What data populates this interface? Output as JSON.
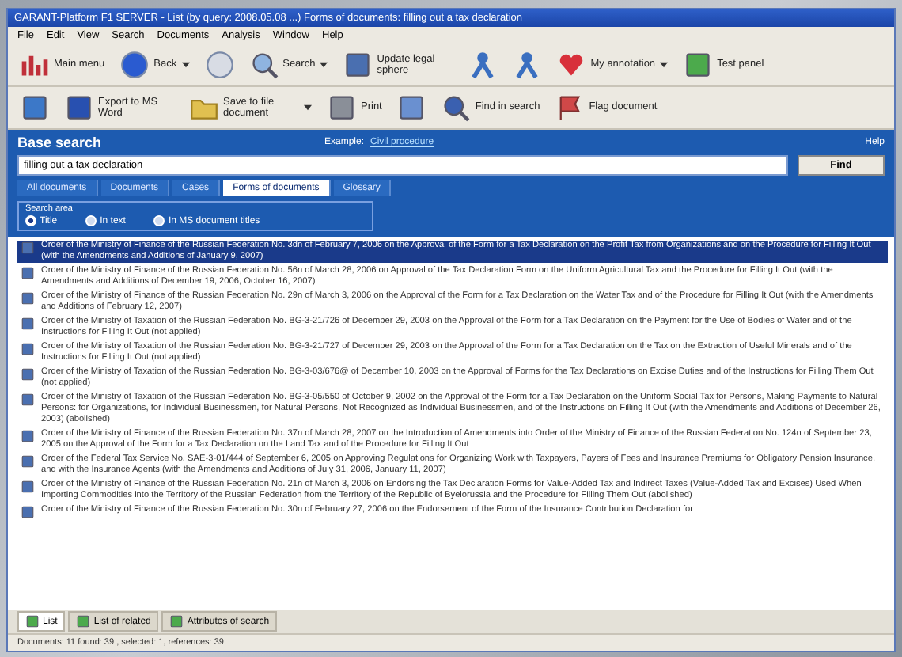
{
  "window": {
    "title": "GARANT-Platform F1 SERVER - List (by query: 2008.05.08 ...) Forms of documents: filling out a tax declaration"
  },
  "menu": [
    "File",
    "Edit",
    "View",
    "Search",
    "Documents",
    "Analysis",
    "Window",
    "Help"
  ],
  "toolbar": [
    {
      "kind": "labeled",
      "label": "Main menu",
      "dropdown": false
    },
    {
      "kind": "labeled",
      "label": "Back",
      "dropdown": true
    },
    {
      "kind": "icon",
      "dropdown": false
    },
    {
      "kind": "labeled",
      "label": "Search",
      "dropdown": true
    },
    {
      "kind": "labeled",
      "label": "Update legal sphere",
      "dropdown": false
    },
    {
      "kind": "icon",
      "dropdown": false
    },
    {
      "kind": "icon",
      "dropdown": false
    },
    {
      "kind": "labeled",
      "label": "My annotation",
      "dropdown": true
    },
    {
      "kind": "labeled",
      "label": "Test panel",
      "dropdown": false
    }
  ],
  "toolbar2": [
    {
      "kind": "icon",
      "dropdown": false
    },
    {
      "kind": "labeled",
      "label": "Export to MS Word",
      "dropdown": false
    },
    {
      "kind": "labeled",
      "label": "Save to file document",
      "dropdown": true
    },
    {
      "kind": "labeled",
      "label": "Print",
      "dropdown": false
    },
    {
      "kind": "icon",
      "dropdown": false
    },
    {
      "kind": "labeled",
      "label": "Find in search",
      "dropdown": false
    },
    {
      "kind": "labeled",
      "label": "Flag document",
      "dropdown": false
    }
  ],
  "search": {
    "title": "Base search",
    "example_label": "Example:",
    "example_link": "Civil procedure",
    "help": "Help",
    "value": "filling out a tax declaration",
    "button": "Find"
  },
  "tabs": [
    {
      "label": "All documents",
      "selected": false
    },
    {
      "label": "Documents",
      "selected": false
    },
    {
      "label": "Cases",
      "selected": false
    },
    {
      "label": "Forms of documents",
      "selected": true
    },
    {
      "label": "Glossary",
      "selected": false
    }
  ],
  "area": {
    "title": "Search area",
    "options": [
      {
        "label": "Title",
        "selected": true
      },
      {
        "label": "In text",
        "selected": false
      },
      {
        "label": "In MS document titles",
        "selected": false
      }
    ]
  },
  "results": [
    {
      "text": "Order of the Ministry of Finance of the Russian Federation No. 3dn of February 7, 2006 on the Approval of the Form for a Tax Declaration on the Profit Tax from Organizations and on the Procedure for Filling It Out (with the Amendments and Additions of January 9, 2007)",
      "selected": true
    },
    {
      "text": "Order of the Ministry of Finance of the Russian Federation No. 56n of March 28, 2006 on Approval of the Tax Declaration Form on the Uniform Agricultural Tax and the Procedure for Filling It Out (with the Amendments and Additions of December 19, 2006, October 16, 2007)",
      "selected": false
    },
    {
      "text": "Order of the Ministry of Finance of the Russian Federation No. 29n of March 3, 2006 on the Approval of the Form for a Tax Declaration on the Water Tax and of the Procedure for Filling It Out (with the Amendments and Additions of February 12, 2007)",
      "selected": false
    },
    {
      "text": "Order of the Ministry of Taxation of the Russian Federation No. BG-3-21/726 of December 29, 2003 on the Approval of the Form for a Tax Declaration on the Payment for the Use of Bodies of Water and of the Instructions for Filling It Out (not applied)",
      "selected": false
    },
    {
      "text": "Order of the Ministry of Taxation of the Russian Federation No. BG-3-21/727 of December 29, 2003 on the Approval of the Form for a Tax Declaration on the Tax on the Extraction of Useful Minerals and of the Instructions for Filling It Out (not applied)",
      "selected": false
    },
    {
      "text": "Order of the Ministry of Taxation of the Russian Federation No. BG-3-03/676@ of December 10, 2003 on the Approval of Forms for the Tax Declarations on Excise Duties and of the Instructions for Filling Them Out (not applied)",
      "selected": false
    },
    {
      "text": "Order of the Ministry of Taxation of the Russian Federation No. BG-3-05/550 of October 9, 2002 on the Approval of the Form for a Tax Declaration on the Uniform Social Tax for Persons, Making Payments to Natural Persons: for Organizations, for Individual Businessmen, for Natural Persons, Not Recognized as Individual Businessmen, and of the Instructions on Filling It Out (with the Amendments and Additions of December 26, 2003) (abolished)",
      "selected": false
    },
    {
      "text": "Order of the Ministry of Finance of the Russian Federation No. 37n of March 28, 2007 on the Introduction of Amendments into Order of the Ministry of Finance of the Russian Federation No. 124n of September 23, 2005 on the Approval of the Form for a Tax Declaration on the Land Tax and of the Procedure for Filling It Out",
      "selected": false
    },
    {
      "text": "Order of the Federal Tax Service No. SAE-3-01/444 of September 6, 2005 on Approving Regulations for Organizing Work with Taxpayers, Payers of Fees and Insurance Premiums for Obligatory Pension Insurance, and with the Insurance Agents (with the Amendments and Additions of July 31, 2006, January 11, 2007)",
      "selected": false
    },
    {
      "text": "Order of the Ministry of Finance of the Russian Federation No. 21n of March 3, 2006 on Endorsing the Tax Declaration Forms for Value-Added Tax and Indirect Taxes (Value-Added Tax and Excises) Used When Importing Commodities into the Territory of the Russian Federation from the Territory of the Republic of Byelorussia and the Procedure for Filling Them Out (abolished)",
      "selected": false
    },
    {
      "text": "Order of the Ministry of Finance of the Russian Federation No. 30n of February 27, 2006 on the Endorsement of the Form of the Insurance Contribution Declaration for",
      "selected": false
    }
  ],
  "bottom_tabs": [
    {
      "label": "List",
      "selected": true
    },
    {
      "label": "List of related",
      "selected": false
    },
    {
      "label": "Attributes of search",
      "selected": false
    }
  ],
  "status_bar": "Documents: 11 found: 39 , selected: 1, references: 39"
}
